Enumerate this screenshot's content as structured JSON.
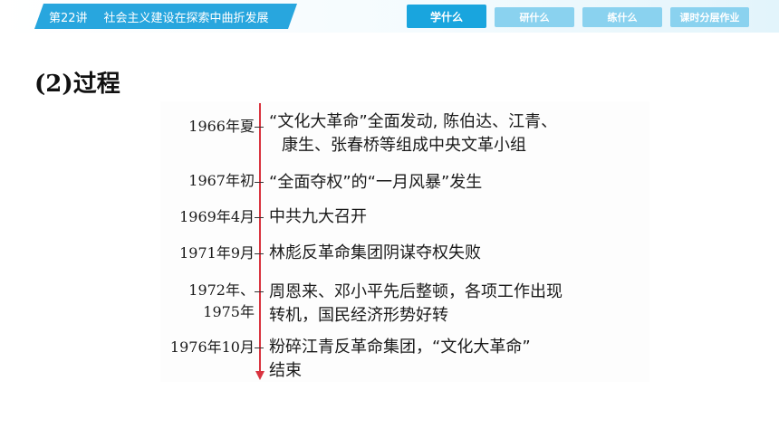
{
  "header": {
    "lesson_number": "第22讲",
    "lesson_title": "社会主义建设在探索中曲折发展",
    "tabs": [
      {
        "label": "学什么",
        "active": true
      },
      {
        "label": "研什么",
        "active": false
      },
      {
        "label": "练什么",
        "active": false
      },
      {
        "label": "课时分层作业",
        "active": false
      }
    ]
  },
  "section": {
    "title": "(2)过程"
  },
  "timeline": {
    "axis_color": "#d9333f",
    "events": [
      {
        "date": "1966年夏",
        "lines": [
          "“文化大革命”全面发动, 陈伯达、江青、",
          "康生、张春桥等组成中央文革小组"
        ]
      },
      {
        "date": "1967年初",
        "lines": [
          "“全面夺权”的“一月风暴”发生"
        ]
      },
      {
        "date": "1969年4月",
        "lines": [
          "中共九大召开"
        ]
      },
      {
        "date": "1971年9月",
        "lines": [
          "林彪反革命集团阴谋夺权失败"
        ]
      },
      {
        "date_lines": [
          "1972年、",
          "1975年"
        ],
        "lines": [
          "周恩来、邓小平先后整顿，各项工作出现",
          "转机，国民经济形势好转"
        ]
      },
      {
        "date": "1976年10月",
        "lines": [
          "粉碎江青反革命集团，“文化大革命”",
          "结束"
        ]
      }
    ]
  },
  "colors": {
    "brand_blue": "#28a6de",
    "tab_light": "#8ad2ef"
  }
}
